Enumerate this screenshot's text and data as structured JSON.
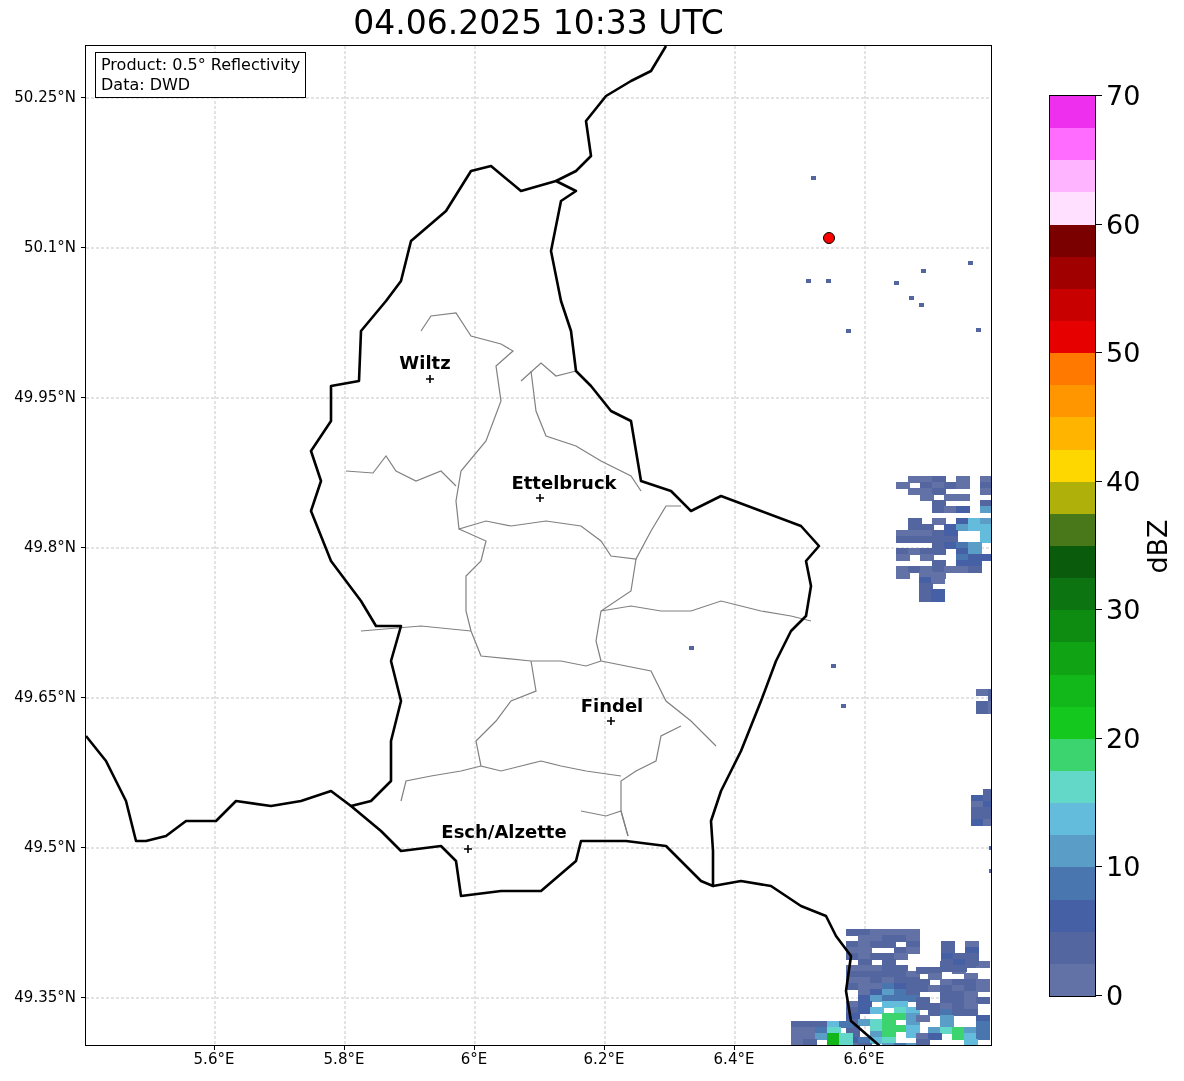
{
  "title": "04.06.2025 10:33 UTC",
  "info_box": [
    "Product: 0.5° Reflectivity",
    "Data: DWD"
  ],
  "y_ticks": [
    "50.25°N",
    "50.1°N",
    "49.95°N",
    "49.8°N",
    "49.65°N",
    "49.5°N",
    "49.35°N"
  ],
  "x_ticks": [
    "5.6°E",
    "5.8°E",
    "6°E",
    "6.2°E",
    "6.4°E",
    "6.6°E"
  ],
  "cities": [
    {
      "name": "Wiltz"
    },
    {
      "name": "Ettelbruck"
    },
    {
      "name": "Findel"
    },
    {
      "name": "Esch/Alzette"
    }
  ],
  "colorbar": {
    "label": "dBZ",
    "ticks": [
      "70",
      "60",
      "50",
      "40",
      "30",
      "20",
      "10",
      "0"
    ],
    "bins": [
      {
        "color": "#ee30ee"
      },
      {
        "color": "#ff6cff"
      },
      {
        "color": "#ffb4ff"
      },
      {
        "color": "#ffe0ff"
      },
      {
        "color": "#7a0000"
      },
      {
        "color": "#a00000"
      },
      {
        "color": "#c80000"
      },
      {
        "color": "#e60000"
      },
      {
        "color": "#ff7800"
      },
      {
        "color": "#ff9600"
      },
      {
        "color": "#ffb400"
      },
      {
        "color": "#ffd700"
      },
      {
        "color": "#b0b00a"
      },
      {
        "color": "#48781a"
      },
      {
        "color": "#0a5c0c"
      },
      {
        "color": "#0c7410"
      },
      {
        "color": "#0e8c12"
      },
      {
        "color": "#10a414"
      },
      {
        "color": "#12b81a"
      },
      {
        "color": "#14c81e"
      },
      {
        "color": "#3cd46e"
      },
      {
        "color": "#64d8c8"
      },
      {
        "color": "#64bcdc"
      },
      {
        "color": "#5a9ec8"
      },
      {
        "color": "#4a76b0"
      },
      {
        "color": "#4560a4"
      },
      {
        "color": "#5366a0"
      },
      {
        "color": "#6272a6"
      }
    ]
  }
}
